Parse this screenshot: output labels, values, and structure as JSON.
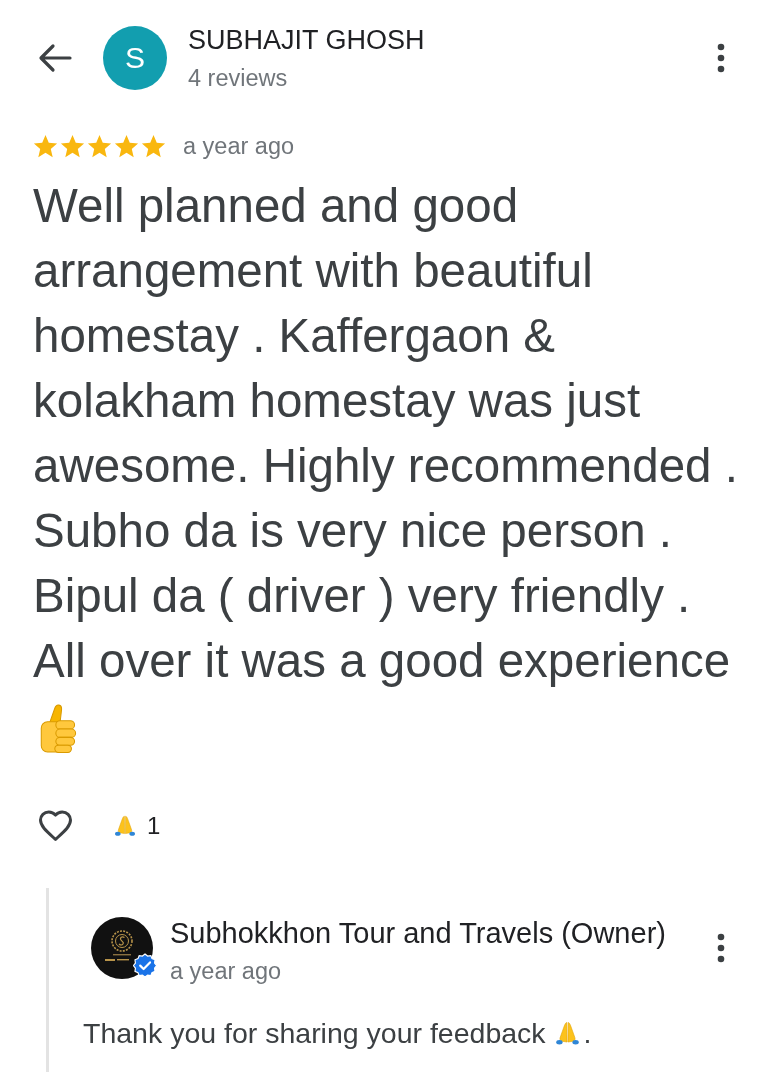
{
  "header": {
    "avatar_letter": "S",
    "name": "SUBHAJIT GHOSH",
    "subtitle": "4 reviews"
  },
  "review": {
    "stars": 5,
    "time": "a year ago",
    "text": "Well planned and good arrangement with beautiful homestay . Kaffergaon & kolakham homestay was just awesome. Highly recommended . Subho da is very nice person . Bipul da ( driver ) very friendly . All over it was a good experience",
    "liked": false,
    "reaction_count": "1"
  },
  "reply": {
    "author": "Subhokkhon Tour and Travels (Owner)",
    "verified": true,
    "time": "a year ago",
    "text": "Thank you for sharing your feedback",
    "text_end": "."
  }
}
